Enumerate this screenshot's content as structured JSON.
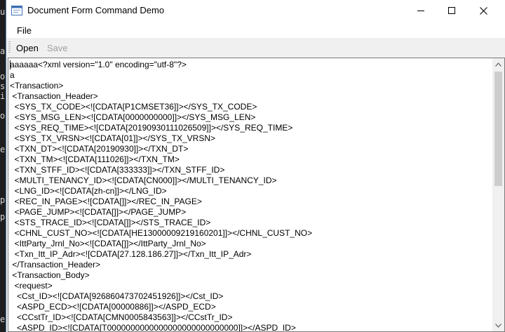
{
  "window": {
    "title": "Document Form Command Demo"
  },
  "menu": {
    "file": "File"
  },
  "toolbar": {
    "open": "Open",
    "save": "Save"
  },
  "background": {
    "chars": [
      "u",
      "a",
      "o",
      "s",
      "in",
      "o",
      "e",
      "p",
      "p",
      "e"
    ]
  },
  "editor": {
    "lines": [
      "aaaaaa<?xml version=\"1.0\" encoding=\"utf-8\"?>",
      "a",
      "<Transaction>",
      " <Transaction_Header>",
      "  <SYS_TX_CODE><![CDATA[P1CMSET36]]></SYS_TX_CODE>",
      "  <SYS_MSG_LEN><![CDATA[0000000000]]></SYS_MSG_LEN>",
      "  <SYS_REQ_TIME><![CDATA[20190930111026509]]></SYS_REQ_TIME>",
      "  <SYS_TX_VRSN><![CDATA[01]]></SYS_TX_VRSN>",
      "  <TXN_DT><![CDATA[20190930]]></TXN_DT>",
      "  <TXN_TM><![CDATA[111026]]></TXN_TM>",
      "  <TXN_STFF_ID><![CDATA[333333]]></TXN_STFF_ID>",
      "  <MULTI_TENANCY_ID><![CDATA[CN000]]></MULTI_TENANCY_ID>",
      "  <LNG_ID><![CDATA[zh-cn]]></LNG_ID>",
      "  <REC_IN_PAGE><![CDATA[]]></REC_IN_PAGE>",
      "  <PAGE_JUMP><![CDATA[]]></PAGE_JUMP>",
      "  <STS_TRACE_ID><![CDATA[]]></STS_TRACE_ID>",
      "  <CHNL_CUST_NO><![CDATA[HE13000009219160201]]></CHNL_CUST_NO>",
      "  <IttParty_Jrnl_No><![CDATA[]]></IttParty_Jrnl_No>",
      "  <Txn_Itt_IP_Adr><![CDATA[27.128.186.27]]></Txn_Itt_IP_Adr>",
      " </Transaction_Header>",
      " <Transaction_Body>",
      "  <request>",
      "   <Cst_ID><![CDATA[926860473702451926]]></Cst_ID>",
      "   <ASPD_ECD><![CDATA[00000886]]></ASPD_ECD>",
      "   <CCstTr_ID><![CDATA[CMN0005843563]]></CCstTr_ID>",
      "   <ASPD_ID><![CDATA[T0000000000000000000000000000]]></ASPD_ID>"
    ]
  },
  "colors": {
    "window_bg": "#f0f0f0",
    "editor_bg": "#ffffff",
    "scroll_thumb": "#cdcdcd"
  }
}
